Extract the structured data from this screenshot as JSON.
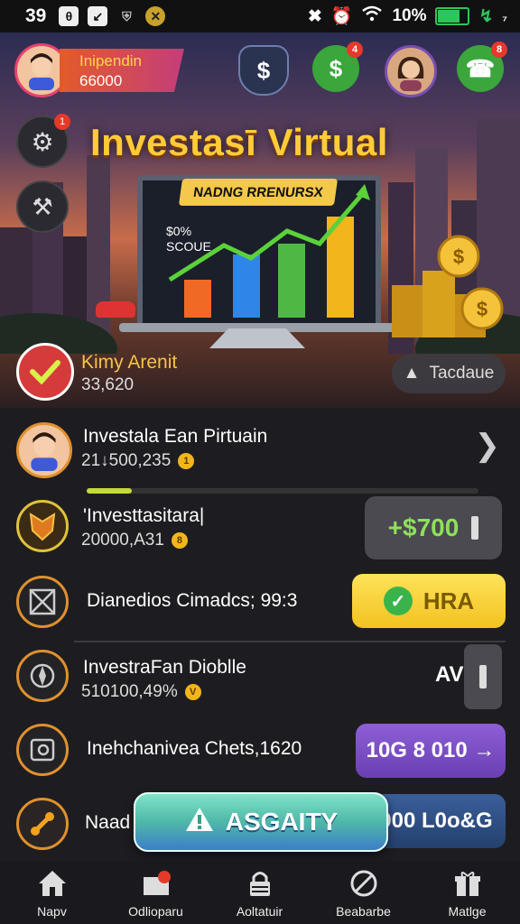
{
  "status_bar": {
    "time": "39",
    "battery": "10%",
    "signal_extra": "₇"
  },
  "hud": {
    "player_name": "Inipendin",
    "player_balance": "66000",
    "cash_badge": "4",
    "phone_badge": "8"
  },
  "side": {
    "settings_badge": "1"
  },
  "hero": {
    "title": "Investasī Virtual",
    "banner": "NADNG RRENURSX",
    "chart_label_1": "$0%",
    "chart_label_2": "SCOUE"
  },
  "player": {
    "name": "Kimy Arenit",
    "score": "33,620",
    "trade_label": "Tacdaue"
  },
  "rows": [
    {
      "title": "Investala Ean Pirtuain",
      "sub": "21↓500,235",
      "coin": "1"
    },
    {
      "title": "'Investtasitara|",
      "sub": "20000,A31",
      "coin": "8",
      "button": "+$700"
    },
    {
      "title": "Dianedios Cimadcs; 99:3",
      "button": "HRA"
    },
    {
      "title": "InvestraFan Dioblle",
      "sub": "510100,49%",
      "coin": "V",
      "side_label": "AV"
    },
    {
      "title": "Inehchanivea Chets,1620",
      "button": "10G 8 010 →"
    },
    {
      "title": "Naad",
      "button": "000 L0o&G"
    }
  ],
  "cta": {
    "label": "ASGAITY"
  },
  "nav": [
    {
      "label": "Napv",
      "icon": "home-icon"
    },
    {
      "label": "Odlioparu",
      "icon": "mail-icon"
    },
    {
      "label": "Aoltatuir",
      "icon": "lock-icon"
    },
    {
      "label": "Beabarbe",
      "icon": "forbidden-icon"
    },
    {
      "label": "Matlge",
      "icon": "gift-icon"
    }
  ],
  "colors": {
    "accent": "#f7c244",
    "orange_ring": "#e0902d",
    "green": "#2ec65b",
    "purple": "#7e4fc2"
  }
}
